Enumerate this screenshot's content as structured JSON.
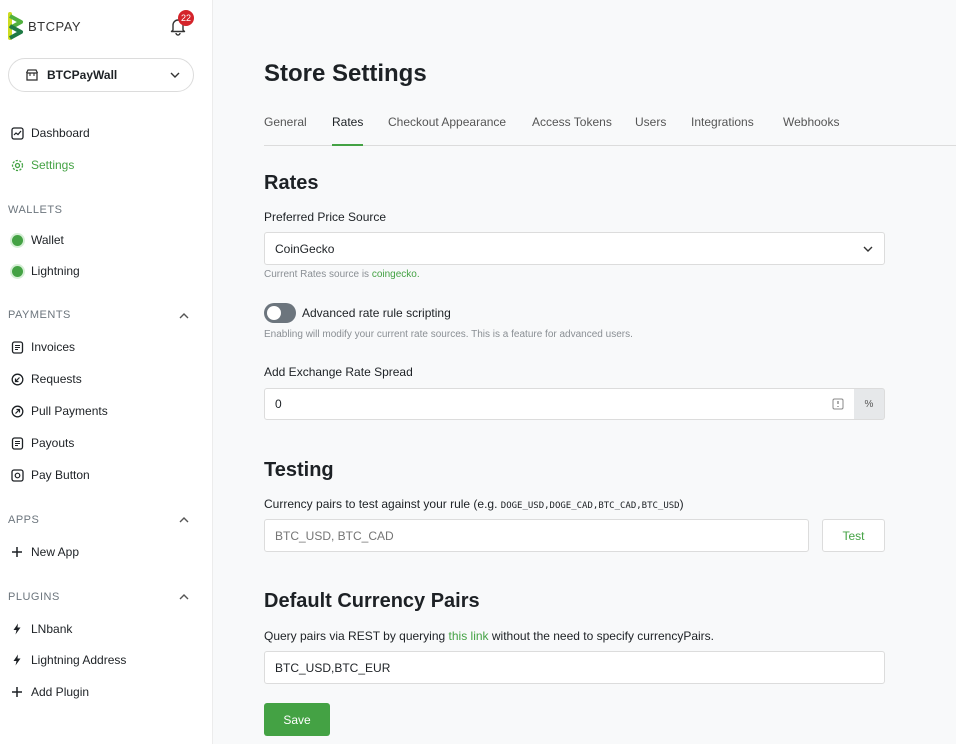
{
  "brand": {
    "name": "BTCPAY",
    "green": "#44a244",
    "notifications": "22"
  },
  "store_selector": {
    "name": "BTCPayWall"
  },
  "nav": {
    "dashboard": "Dashboard",
    "settings": "Settings",
    "wallets_label": "WALLETS",
    "wallet": "Wallet",
    "lightning": "Lightning",
    "payments_label": "PAYMENTS",
    "invoices": "Invoices",
    "requests": "Requests",
    "pull_payments": "Pull Payments",
    "payouts": "Payouts",
    "pay_button": "Pay Button",
    "apps_label": "APPS",
    "new_app": "New App",
    "plugins_label": "PLUGINS",
    "lnbank": "LNbank",
    "lightning_address": "Lightning Address",
    "add_plugin": "Add Plugin"
  },
  "page": {
    "title": "Store Settings",
    "tabs": [
      "General",
      "Rates",
      "Checkout Appearance",
      "Access Tokens",
      "Users",
      "Integrations",
      "Webhooks"
    ],
    "active_tab": "Rates"
  },
  "rates": {
    "heading": "Rates",
    "price_source_label": "Preferred Price Source",
    "price_source_value": "CoinGecko",
    "current_source_prefix": "Current Rates source is ",
    "current_source_link": "coingecko.",
    "advanced_label": "Advanced rate rule scripting",
    "advanced_help": "Enabling will modify your current rate sources. This is a feature for advanced users.",
    "spread_label": "Add Exchange Rate Spread",
    "spread_value": "0",
    "spread_unit": "%"
  },
  "testing": {
    "heading": "Testing",
    "label_prefix": "Currency pairs to test against your rule (e.g. ",
    "label_code": "DOGE_USD,DOGE_CAD,BTC_CAD,BTC_USD",
    "label_suffix": ")",
    "placeholder": "BTC_USD, BTC_CAD",
    "test_button": "Test"
  },
  "default_pairs": {
    "heading": "Default Currency Pairs",
    "help_prefix": "Query pairs via REST by querying ",
    "help_link": "this link",
    "help_suffix": " without the need to specify currencyPairs.",
    "value": "BTC_USD,BTC_EUR"
  },
  "save_button": "Save"
}
